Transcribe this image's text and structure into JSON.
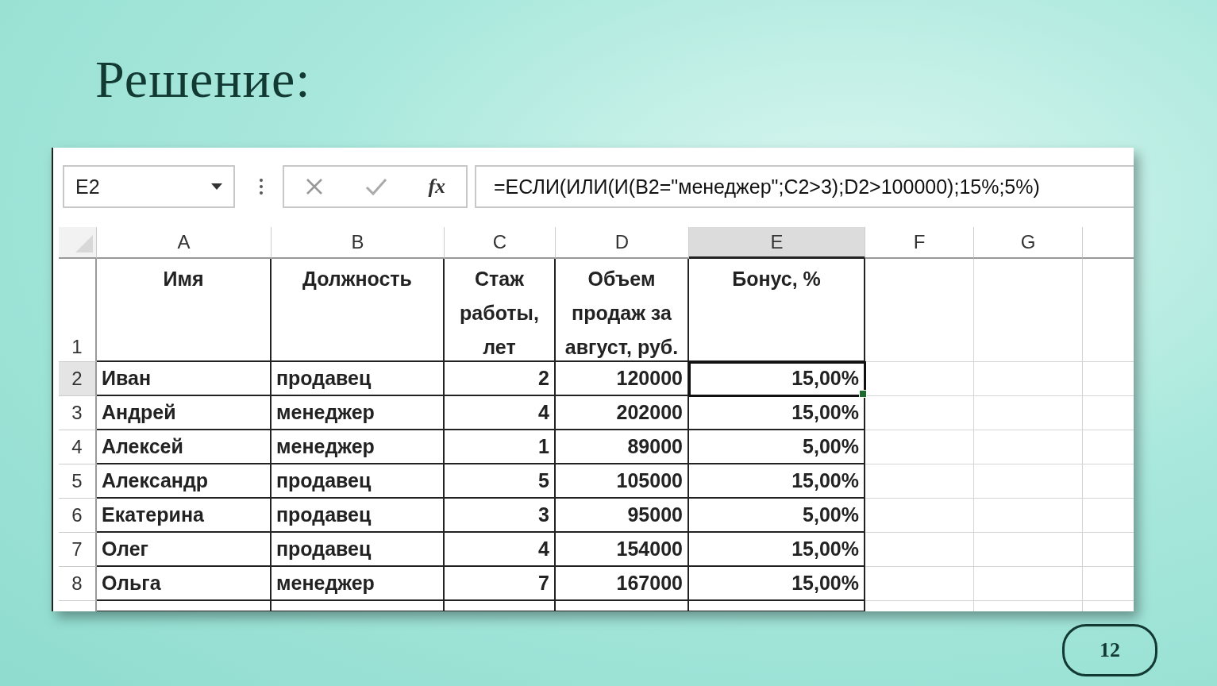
{
  "slide": {
    "title": "Решение:",
    "page_number": "12"
  },
  "name_box": {
    "value": "E2"
  },
  "formula_bar": {
    "function_label": "fx",
    "formula": "=ЕСЛИ(ИЛИ(И(B2=\"менеджер\";C2>3);D2>100000);15%;5%)"
  },
  "columns": [
    {
      "label": "A",
      "selected": false
    },
    {
      "label": "B",
      "selected": false
    },
    {
      "label": "C",
      "selected": false
    },
    {
      "label": "D",
      "selected": false
    },
    {
      "label": "E",
      "selected": true
    },
    {
      "label": "F",
      "selected": false
    },
    {
      "label": "G",
      "selected": false
    }
  ],
  "rows": [
    {
      "number": "1",
      "selected": false,
      "cells": [
        "Имя",
        "Должность",
        "Стаж работы, лет",
        "Объем продаж за август, руб.",
        "Бонус, %"
      ]
    },
    {
      "number": "2",
      "selected": true,
      "cells": [
        "Иван",
        "продавец",
        "2",
        "120000",
        "15,00%"
      ]
    },
    {
      "number": "3",
      "selected": false,
      "cells": [
        "Андрей",
        "менеджер",
        "4",
        "202000",
        "15,00%"
      ]
    },
    {
      "number": "4",
      "selected": false,
      "cells": [
        "Алексей",
        "менеджер",
        "1",
        "89000",
        "5,00%"
      ]
    },
    {
      "number": "5",
      "selected": false,
      "cells": [
        "Александр",
        "продавец",
        "5",
        "105000",
        "15,00%"
      ]
    },
    {
      "number": "6",
      "selected": false,
      "cells": [
        "Екатерина",
        "продавец",
        "3",
        "95000",
        "5,00%"
      ]
    },
    {
      "number": "7",
      "selected": false,
      "cells": [
        "Олег",
        "продавец",
        "4",
        "154000",
        "15,00%"
      ]
    },
    {
      "number": "8",
      "selected": false,
      "cells": [
        "Ольга",
        "менеджер",
        "7",
        "167000",
        "15,00%"
      ]
    }
  ]
}
